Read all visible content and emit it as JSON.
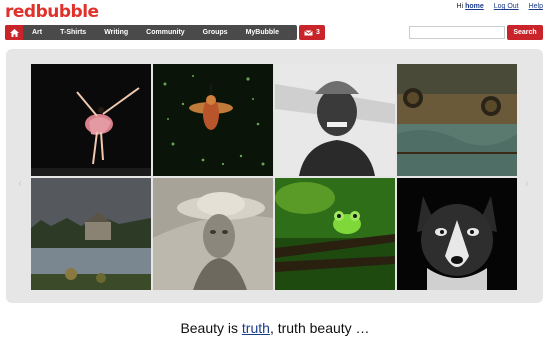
{
  "logo": {
    "part1": "red",
    "part2": "bubble"
  },
  "user": {
    "greeting": "Hi",
    "name": "home",
    "logout": "Log Out",
    "help": "Help"
  },
  "nav": {
    "home_icon": "home-icon",
    "items": [
      "Art",
      "T-Shirts",
      "Writing",
      "Community",
      "Groups",
      "MyBubble"
    ],
    "messages_count": "3",
    "messages_icon": "envelope-icon"
  },
  "search": {
    "placeholder": "",
    "button": "Search"
  },
  "gallery": {
    "prev_icon": "chevron-left-icon",
    "next_icon": "chevron-right-icon"
  },
  "caption": {
    "before": "Beauty is ",
    "link": "truth",
    "after": ", truth beauty …"
  },
  "colors": {
    "brand": "#e0312b",
    "nav_bg": "#4a4a4a",
    "link": "#1a3c8a"
  }
}
